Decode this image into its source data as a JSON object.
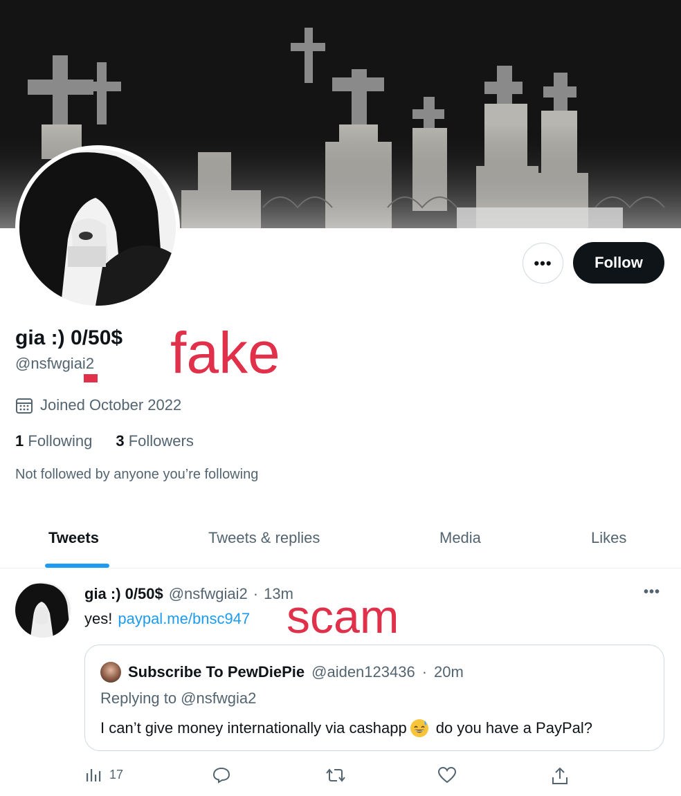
{
  "profile": {
    "display_name": "gia :) 0/50$",
    "handle": "@nsfwgiai2",
    "joined": "Joined October 2022",
    "following_count": "1",
    "following_label": "Following",
    "followers_count": "3",
    "followers_label": "Followers",
    "not_followed": "Not followed by anyone you’re following"
  },
  "buttons": {
    "more": "•••",
    "follow": "Follow"
  },
  "annotations": {
    "fake": "fake",
    "scam": "scam"
  },
  "tabs": [
    {
      "label": "Tweets",
      "active": true
    },
    {
      "label": "Tweets & replies",
      "active": false
    },
    {
      "label": "Media",
      "active": false
    },
    {
      "label": "Likes",
      "active": false
    }
  ],
  "tweet": {
    "name": "gia :) 0/50$",
    "handle": "@nsfwgiai2",
    "separator": "·",
    "time": "13m",
    "more": "•••",
    "text": "yes!",
    "link": "paypal.me/bnsc947",
    "views": "17",
    "quote": {
      "name": "Subscribe To PewDiePie",
      "handle": "@aiden123436",
      "separator": "·",
      "time": "20m",
      "replying_to": "Replying to @nsfwgia2",
      "text_before": "I can’t give money internationally via cashapp",
      "emoji": "grinning-face-with-sweat",
      "text_after": "do you have a PayPal?"
    }
  },
  "colors": {
    "accent": "#1d9bf0",
    "annotation_red": "#e0304a",
    "text_primary": "#0f1419",
    "text_secondary": "#536471"
  },
  "icons": [
    "calendar-icon",
    "views-icon",
    "reply-icon",
    "retweet-icon",
    "like-icon",
    "share-icon"
  ]
}
